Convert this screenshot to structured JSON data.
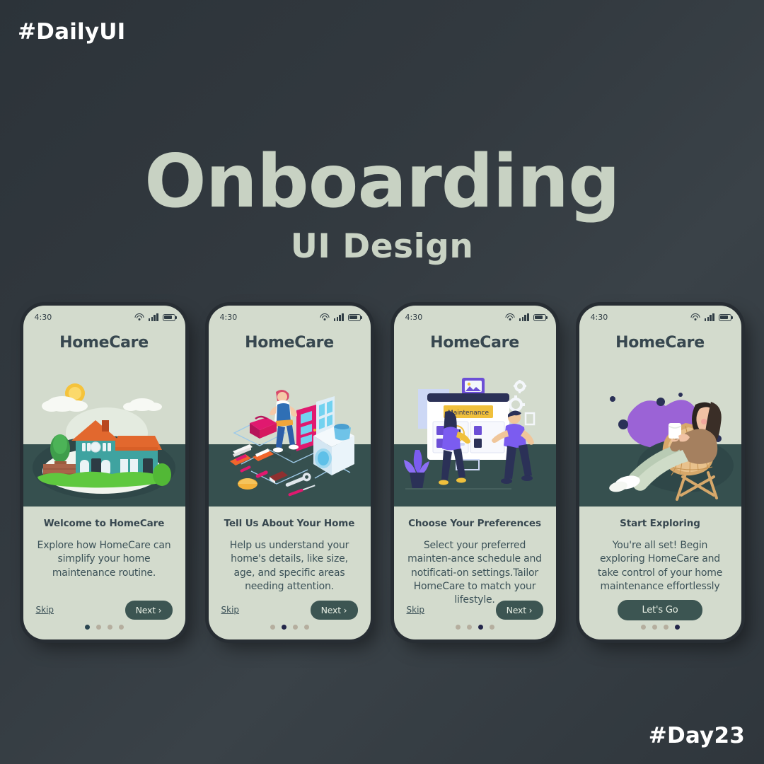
{
  "poster": {
    "top_tag": "#DailyUI",
    "bottom_tag": "#Day23",
    "title": "Onboarding",
    "subtitle": "UI Design",
    "bg_start": "#2c3339",
    "bg_end": "#2f363c",
    "title_color": "#c8d2c3"
  },
  "phone_common": {
    "status_time": "4:30",
    "app_name": "HomeCare",
    "screen_bg": "#d3dbcd",
    "band_color": "#36504f",
    "accent": "#3c5552",
    "text_color": "#37474f",
    "icons": [
      "wifi-icon",
      "signal-icon",
      "battery-icon"
    ]
  },
  "screens": [
    {
      "app_name": "HomeCare",
      "status_time": "4:30",
      "headline": "Welcome to HomeCare",
      "body": "Explore how HomeCare can simplify your home maintenance routine.",
      "skip_label": "Skip",
      "next_label": "Next ›",
      "illustration": "house-with-sun-and-clouds",
      "active_dot": 0,
      "dot_count": 4
    },
    {
      "app_name": "HomeCare",
      "status_time": "4:30",
      "headline": "Tell Us About Your Home",
      "body": "Help us understand your home's details, like size, age, and specific areas needing attention.",
      "skip_label": "Skip",
      "next_label": "Next ›",
      "illustration": "handyman-with-tools-isometric",
      "active_dot": 1,
      "dot_count": 4
    },
    {
      "app_name": "HomeCare",
      "status_time": "4:30",
      "headline": "Choose Your Preferences",
      "body": "Select your preferred mainten-ance schedule and notificati-on settings.Tailor HomeCare to match your lifestyle.",
      "skip_label": "Skip",
      "next_label": "Next ›",
      "illustration": "people-at-maintenance-dashboard",
      "illustration_label": "Maintenance",
      "active_dot": 2,
      "dot_count": 4
    },
    {
      "app_name": "HomeCare",
      "status_time": "4:30",
      "headline": "Start Exploring",
      "body": "You're all set! Begin exploring HomeCare and take control of your home maintenance effortlessly",
      "cta_label": "Let's Go",
      "illustration": "woman-relaxing-in-chair",
      "active_dot": 3,
      "dot_count": 4
    }
  ]
}
